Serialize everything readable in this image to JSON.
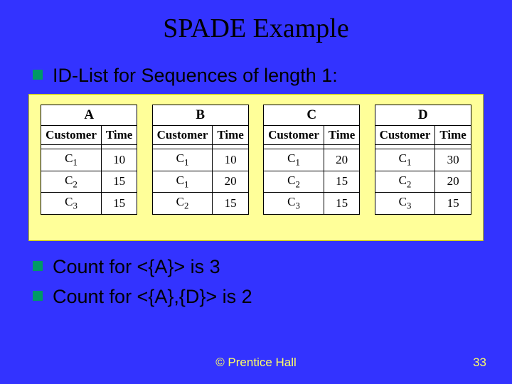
{
  "title": "SPADE Example",
  "bullets": {
    "b1": "ID-List for Sequences of length 1:",
    "b2": "Count for <{A}> is 3",
    "b3": "Count for <{A},{D}> is 2"
  },
  "tables": [
    {
      "label": "A",
      "col1": "Customer",
      "col2": "Time",
      "rows": [
        {
          "c": "C",
          "s": "1",
          "t": "10"
        },
        {
          "c": "C",
          "s": "2",
          "t": "15"
        },
        {
          "c": "C",
          "s": "3",
          "t": "15"
        }
      ]
    },
    {
      "label": "B",
      "col1": "Customer",
      "col2": "Time",
      "rows": [
        {
          "c": "C",
          "s": "1",
          "t": "10"
        },
        {
          "c": "C",
          "s": "1",
          "t": "20"
        },
        {
          "c": "C",
          "s": "2",
          "t": "15"
        }
      ]
    },
    {
      "label": "C",
      "col1": "Customer",
      "col2": "Time",
      "rows": [
        {
          "c": "C",
          "s": "1",
          "t": "20"
        },
        {
          "c": "C",
          "s": "2",
          "t": "15"
        },
        {
          "c": "C",
          "s": "3",
          "t": "15"
        }
      ]
    },
    {
      "label": "D",
      "col1": "Customer",
      "col2": "Time",
      "rows": [
        {
          "c": "C",
          "s": "1",
          "t": "30"
        },
        {
          "c": "C",
          "s": "2",
          "t": "20"
        },
        {
          "c": "C",
          "s": "3",
          "t": "15"
        }
      ]
    }
  ],
  "footer": "© Prentice Hall",
  "page": "33"
}
